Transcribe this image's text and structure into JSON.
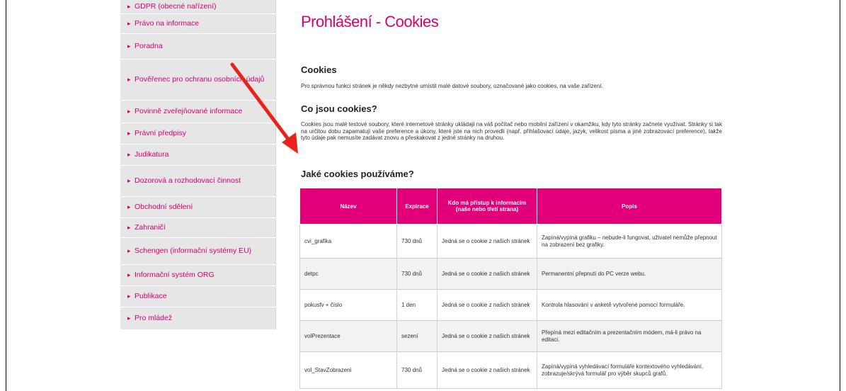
{
  "sidebar": {
    "items": [
      {
        "label": "GDPR (obecné nařízení)"
      },
      {
        "label": "Právo na informace"
      },
      {
        "label": "Poradna"
      },
      {
        "label": "Pověřenec pro ochranu osobních údajů"
      },
      {
        "label": "Povinně zveřejňované informace"
      },
      {
        "label": "Právní předpisy"
      },
      {
        "label": "Judikatura"
      },
      {
        "label": "Dozorová a rozhodovací činnost"
      },
      {
        "label": "Obchodní sdělení"
      },
      {
        "label": "Zahraničí"
      },
      {
        "label": "Schengen (informační systémy EU)"
      },
      {
        "label": "Informační systém ORG"
      },
      {
        "label": "Publikace"
      },
      {
        "label": "Pro mládež"
      }
    ]
  },
  "main": {
    "title": "Prohlášení - Cookies",
    "section1_heading": "Cookies",
    "section1_text": "Pro správnou funkci stránek je někdy nezbytné umístit malé datové soubory, označované jako cookies, na vaše zařízení.",
    "section2_heading": "Co jsou cookies?",
    "section2_text": "Cookies jsou malé textové soubory, které internetové stránky ukládají na váš počítač nebo mobilní zařízení v okamžiku, kdy tyto stránky začnete využívat. Stránky si tak na určitou dobu zapamatují vaše preference a úkony, které jste na nich provedli (např. přihlašovací údaje, jazyk, velikost písma a jiné zobrazovací preference), takže tyto údaje pak nemusíte zadávat znovu a přeskakovat z jedné stránky na druhou.",
    "section3_heading": "Jaké cookies používáme?"
  },
  "table": {
    "headers": {
      "name": "Název",
      "expiry": "Expirace",
      "access": "Kdo má přístup k informacím (naše nebo třetí strana)",
      "description": "Popis"
    },
    "rows": [
      {
        "name": "cvi_grafika",
        "expiry": "730 dnů",
        "access": "Jedná se o cookie z našich stránek",
        "description": "Zapíná/vypíná grafiku – nebude-li fungovat, uživatel nemůže přepnout na zobrazení bez grafiky."
      },
      {
        "name": "detpc",
        "expiry": "730 dnů",
        "access": "Jedná se o cookie z našich stránek",
        "description": "Permanentní přepnutí do PC verze webu."
      },
      {
        "name": "pokusfv + číslo",
        "expiry": "1 den",
        "access": "Jedná se o cookie z našich stránek",
        "description": "Kontrola hlasování v anketě vytvořené pomocí formuláře."
      },
      {
        "name": "volPrezentace",
        "expiry": "sezení",
        "access": "Jedná se o cookie z našich stránek",
        "description": "Přepíná mezi editačním a prezentačním módem, má-li právo na editaci."
      },
      {
        "name": "vol_StavZobrazeni",
        "expiry": "730 dnů",
        "access": "Jedná se o cookie z našich stránek",
        "description": "Zapíná/vypíná vyhledávací formuláře kontextového vyhledávání, zobrazuje/skrývá formulář pro výběr skupců grafů."
      }
    ]
  },
  "colors": {
    "accent": "#e2007a",
    "sidebar_bg": "#e6e6e6",
    "annotation_arrow": "#e8231c"
  },
  "icons": {
    "bullet": "chevron-right-icon",
    "annotation": "red-arrow-annotation"
  }
}
